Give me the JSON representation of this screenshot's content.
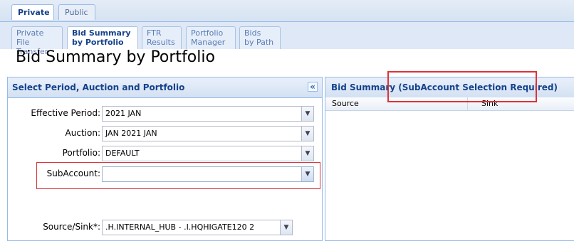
{
  "top_tabs": {
    "active": "Private",
    "inactive": "Public"
  },
  "sub_tabs": [
    {
      "line1": "Private File",
      "line2": "Transfer"
    },
    {
      "line1": "Bid Summary",
      "line2": "by Portfolio"
    },
    {
      "line1": "FTR",
      "line2": "Results"
    },
    {
      "line1": "Portfolio",
      "line2": "Manager"
    },
    {
      "line1": "Bids",
      "line2": "by Path"
    }
  ],
  "page_title": "Bid Summary by Portfolio",
  "left_panel": {
    "title": "Select Period, Auction and Portfolio",
    "collapse_glyph": "«",
    "fields": {
      "effective_period": {
        "label": "Effective Period:",
        "value": "2021 JAN"
      },
      "auction": {
        "label": "Auction:",
        "value": "JAN 2021 JAN"
      },
      "portfolio": {
        "label": "Portfolio:",
        "value": "DEFAULT"
      },
      "subaccount": {
        "label": "SubAccount:",
        "value": ""
      },
      "source_sink": {
        "label": "Source/Sink*:",
        "value": ".H.INTERNAL_HUB - .I.HQHIGATE120 2"
      }
    }
  },
  "right_panel": {
    "title": "Bid Summary (SubAccount Selection Required)",
    "columns": [
      "Source",
      "Sink"
    ]
  },
  "colors": {
    "highlight": "#e03237",
    "accent": "#15428b"
  }
}
